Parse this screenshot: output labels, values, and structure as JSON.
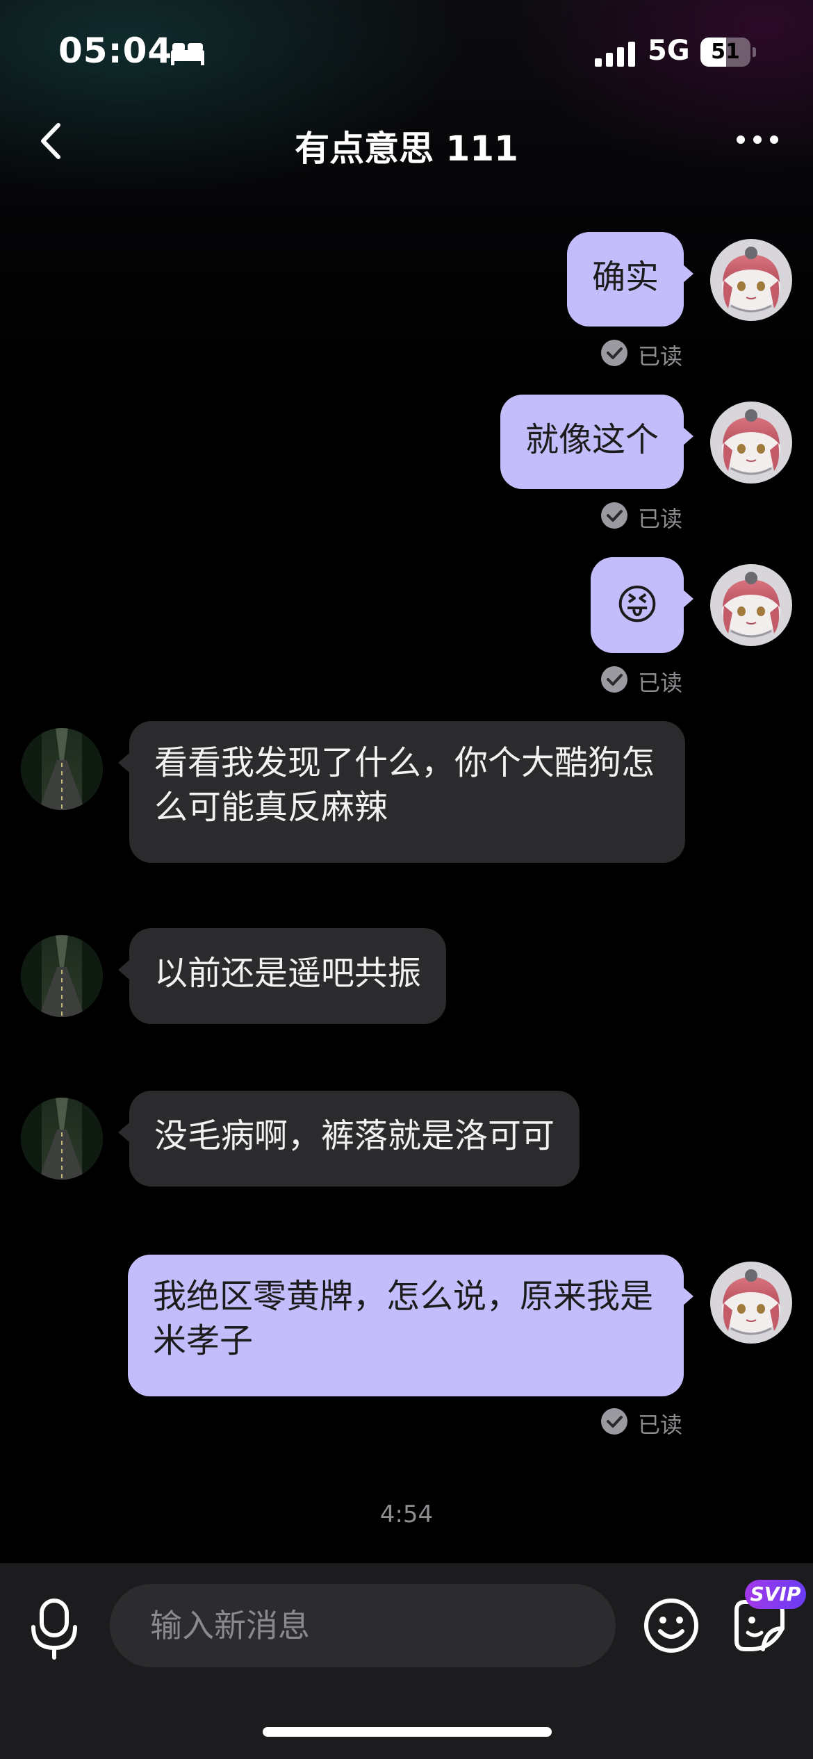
{
  "status_bar": {
    "time": "05:04",
    "network": "5G",
    "battery": "51",
    "battery_level": 0.51
  },
  "header": {
    "title": "有点意思 111"
  },
  "messages": [
    {
      "side": "me",
      "text": "确实",
      "read_label": "已读"
    },
    {
      "side": "me",
      "text": "就像这个",
      "read_label": "已读"
    },
    {
      "side": "me",
      "emoji": "😝",
      "read_label": "已读"
    },
    {
      "side": "other",
      "text": "看看我发现了什么，你个大酷狗怎么可能真反麻辣"
    },
    {
      "side": "other",
      "text": "以前还是遥吧共振"
    },
    {
      "side": "other",
      "text": "没毛病啊，裤落就是洛可可"
    },
    {
      "side": "me",
      "text": "我绝区零黄牌，怎么说，原来我是米孝子",
      "read_label": "已读"
    }
  ],
  "timestamp": "4:54",
  "input_bar": {
    "placeholder": "输入新消息",
    "badge": "SVIP"
  },
  "colors": {
    "my_bubble": "#c4bdfb",
    "other_bubble": "#2b2b2e",
    "background": "#000000",
    "svip_badge": "#8a3cf0"
  }
}
